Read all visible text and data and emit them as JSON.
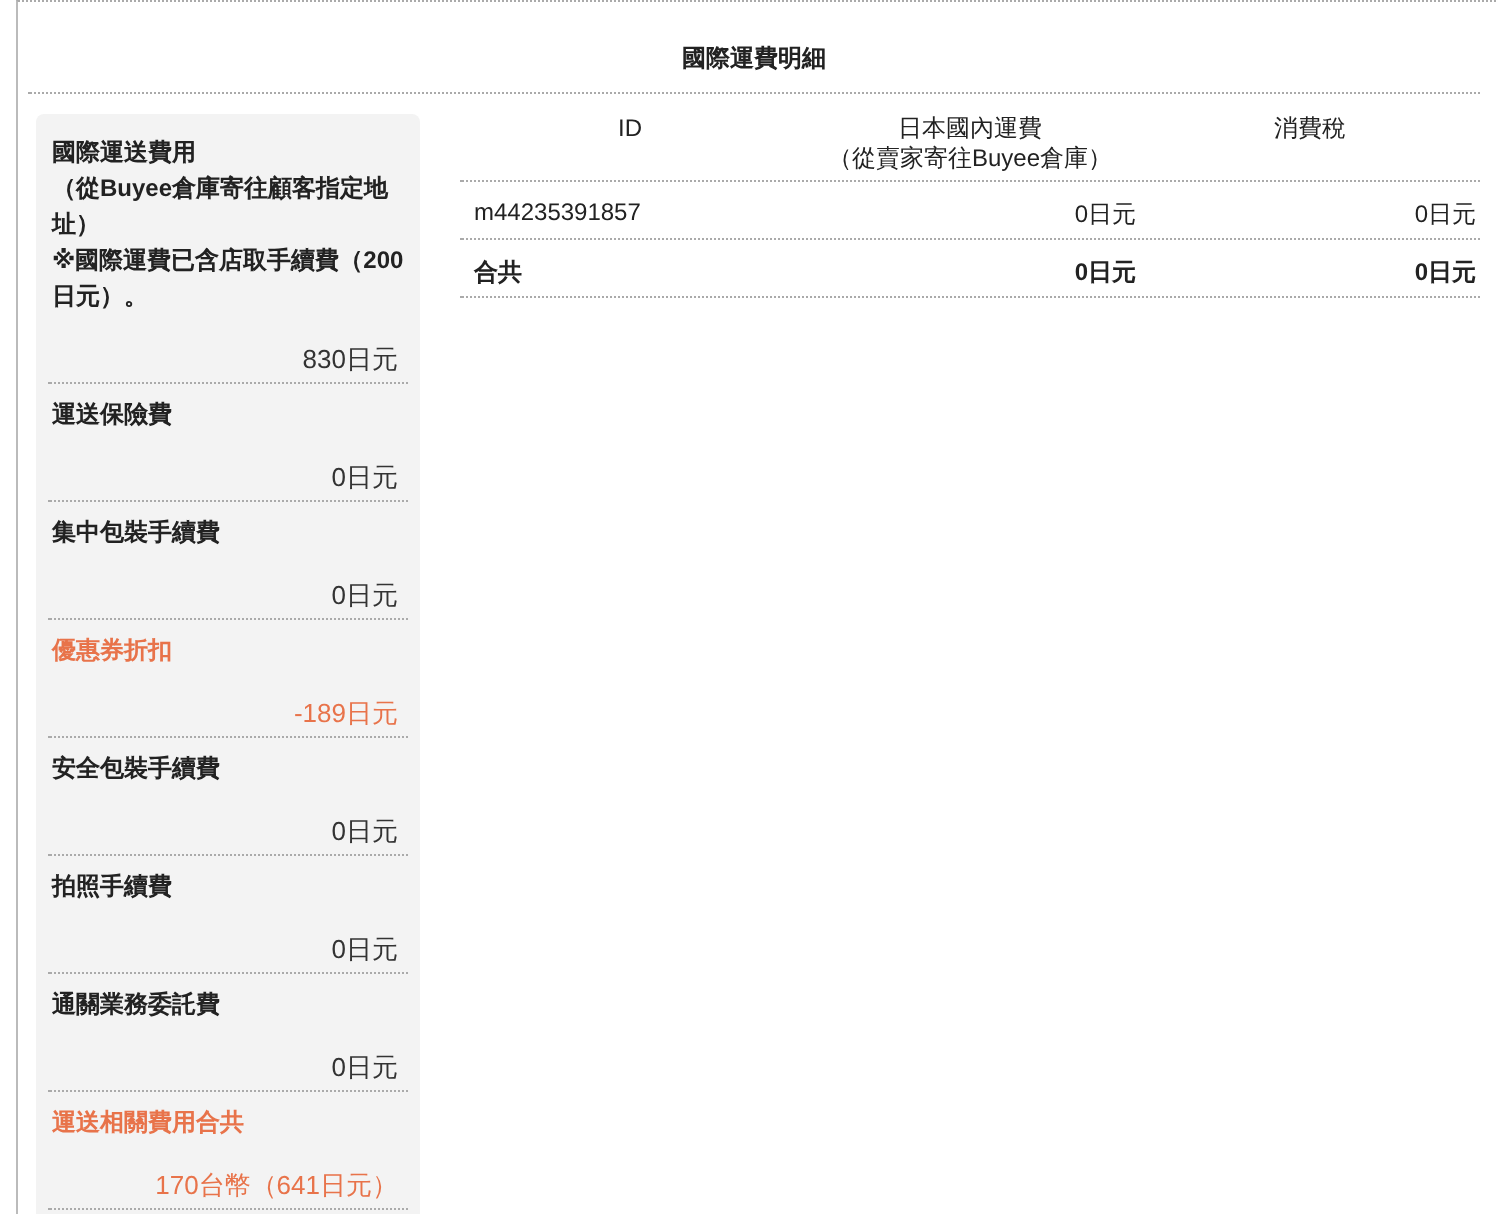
{
  "title": "國際運費明細",
  "fees": [
    {
      "label": "國際運送費用",
      "notes": [
        "（從Buyee倉庫寄往顧客指定地址）",
        "※國際運費已含店取手續費（200日元）。"
      ],
      "value": "830日元",
      "highlighted": false
    },
    {
      "label": "運送保險費",
      "value": "0日元",
      "highlighted": false
    },
    {
      "label": "集中包裝手續費",
      "value": "0日元",
      "highlighted": false
    },
    {
      "label": "優惠券折扣",
      "value": "-189日元",
      "highlighted": true
    },
    {
      "label": "安全包裝手續費",
      "value": "0日元",
      "highlighted": false
    },
    {
      "label": "拍照手續費",
      "value": "0日元",
      "highlighted": false
    },
    {
      "label": "通關業務委託費",
      "value": "0日元",
      "highlighted": false
    },
    {
      "label": "運送相關費用合共",
      "value": "170台幣（641日元）",
      "highlighted": true
    }
  ],
  "table": {
    "columns": [
      {
        "title": "ID"
      },
      {
        "title": "日本國內運費",
        "subtitle": "（從賣家寄往Buyee倉庫）"
      },
      {
        "title": "消費稅"
      }
    ],
    "rows": [
      {
        "kind": "item",
        "cells": [
          "m44235391857",
          "0日元",
          "0日元"
        ]
      },
      {
        "kind": "total",
        "cells": [
          "合共",
          "0日元",
          "0日元"
        ]
      }
    ]
  }
}
